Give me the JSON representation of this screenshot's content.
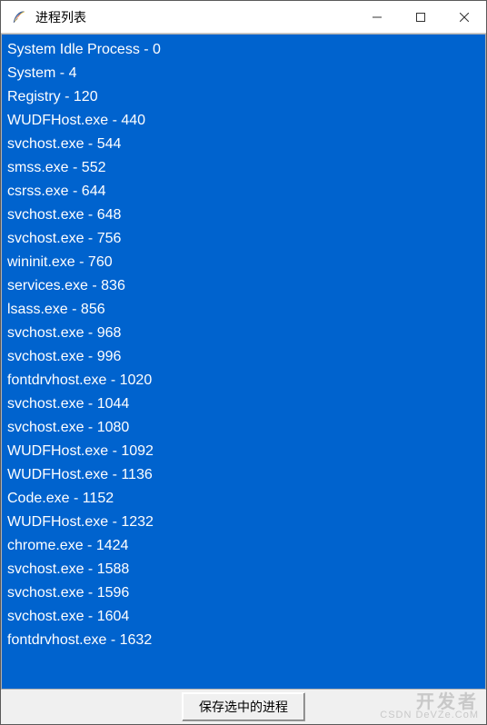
{
  "window": {
    "title": "进程列表"
  },
  "titlebar_controls": {
    "minimize": "—",
    "maximize": "☐",
    "close": "✕"
  },
  "processes": [
    {
      "name": "System Idle Process",
      "pid": 0
    },
    {
      "name": "System",
      "pid": 4
    },
    {
      "name": "Registry",
      "pid": 120
    },
    {
      "name": "WUDFHost.exe",
      "pid": 440
    },
    {
      "name": "svchost.exe",
      "pid": 544
    },
    {
      "name": "smss.exe",
      "pid": 552
    },
    {
      "name": "csrss.exe",
      "pid": 644
    },
    {
      "name": "svchost.exe",
      "pid": 648
    },
    {
      "name": "svchost.exe",
      "pid": 756
    },
    {
      "name": "wininit.exe",
      "pid": 760
    },
    {
      "name": "services.exe",
      "pid": 836
    },
    {
      "name": "lsass.exe",
      "pid": 856
    },
    {
      "name": "svchost.exe",
      "pid": 968
    },
    {
      "name": "svchost.exe",
      "pid": 996
    },
    {
      "name": "fontdrvhost.exe",
      "pid": 1020
    },
    {
      "name": "svchost.exe",
      "pid": 1044
    },
    {
      "name": "svchost.exe",
      "pid": 1080
    },
    {
      "name": "WUDFHost.exe",
      "pid": 1092
    },
    {
      "name": "WUDFHost.exe",
      "pid": 1136
    },
    {
      "name": "Code.exe",
      "pid": 1152
    },
    {
      "name": "WUDFHost.exe",
      "pid": 1232
    },
    {
      "name": "chrome.exe",
      "pid": 1424
    },
    {
      "name": "svchost.exe",
      "pid": 1588
    },
    {
      "name": "svchost.exe",
      "pid": 1596
    },
    {
      "name": "svchost.exe",
      "pid": 1604
    },
    {
      "name": "fontdrvhost.exe",
      "pid": 1632
    }
  ],
  "buttons": {
    "save_selected": "保存选中的进程"
  },
  "watermark": {
    "main": "开发者",
    "sub": "CSDN DeVZe.CoM"
  },
  "colors": {
    "list_background": "#0063ce",
    "list_text": "#ffffff"
  }
}
